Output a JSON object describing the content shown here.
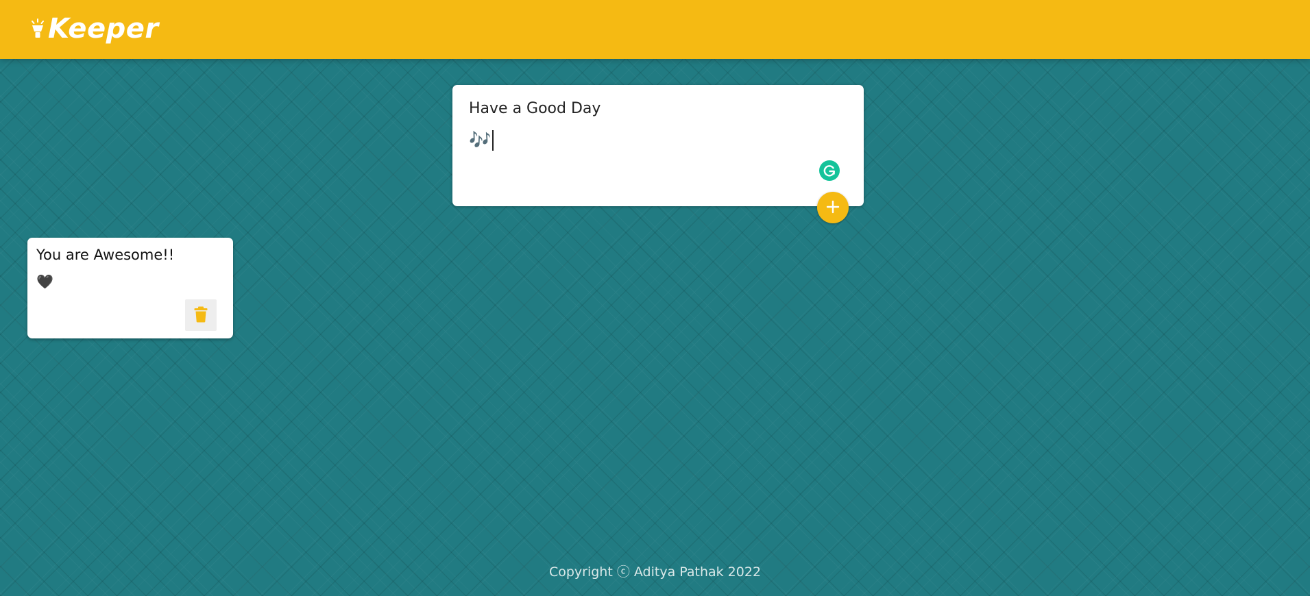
{
  "header": {
    "title": "Keeper",
    "logo_icon": "lightbulb-icon"
  },
  "create_note": {
    "title_value": "Have a Good Day",
    "content_value": "🎶",
    "add_icon": "plus-icon",
    "grammarly_icon": "grammarly-icon"
  },
  "notes": [
    {
      "title": "You are Awesome!!",
      "content": "🖤",
      "delete_icon": "trash-icon"
    }
  ],
  "footer": {
    "copyright": "Copyright ⓒ Aditya Pathak 2022"
  },
  "colors": {
    "header_bg": "#f5ba13",
    "page_bg": "#217b82",
    "accent": "#f5ba13",
    "grammarly": "#15c39a",
    "card_bg": "#ffffff"
  }
}
